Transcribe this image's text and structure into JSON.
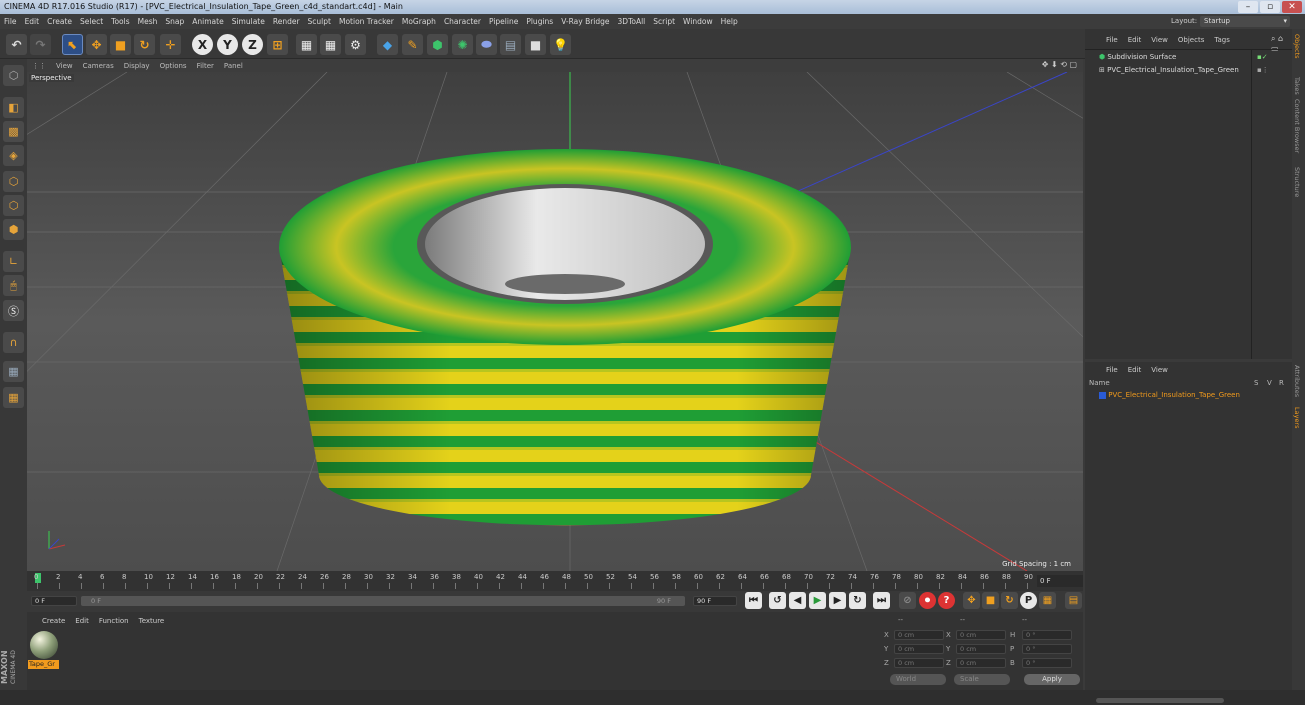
{
  "window": {
    "title": "CINEMA 4D R17.016 Studio (R17) - [PVC_Electrical_Insulation_Tape_Green_c4d_standart.c4d] - Main"
  },
  "menu": [
    "File",
    "Edit",
    "Create",
    "Select",
    "Tools",
    "Mesh",
    "Snap",
    "Animate",
    "Simulate",
    "Render",
    "Sculpt",
    "Motion Tracker",
    "MoGraph",
    "Character",
    "Pipeline",
    "Plugins",
    "V-Ray Bridge",
    "3DToAll",
    "Script",
    "Window",
    "Help"
  ],
  "layout": {
    "label": "Layout:",
    "value": "Startup"
  },
  "toolbar": {
    "x": "X",
    "y": "Y",
    "z": "Z"
  },
  "viewport": {
    "menu": [
      "View",
      "Cameras",
      "Display",
      "Options",
      "Filter",
      "Panel"
    ],
    "label": "Perspective",
    "grid_spacing": "Grid Spacing : 1 cm"
  },
  "timeline": {
    "ticks": [
      "0",
      "2",
      "4",
      "6",
      "8",
      "10",
      "12",
      "14",
      "16",
      "18",
      "20",
      "22",
      "24",
      "26",
      "28",
      "30",
      "32",
      "34",
      "36",
      "38",
      "40",
      "42",
      "44",
      "46",
      "48",
      "50",
      "52",
      "54",
      "56",
      "58",
      "60",
      "62",
      "64",
      "66",
      "68",
      "70",
      "72",
      "74",
      "76",
      "78",
      "80",
      "82",
      "84",
      "86",
      "88",
      "90"
    ],
    "current": "0 F"
  },
  "transport": {
    "start": "0 F",
    "slider_start": "0 F",
    "slider_end": "90 F",
    "end": "90 F"
  },
  "material_manager": {
    "menu": [
      "Create",
      "Edit",
      "Function",
      "Texture"
    ],
    "material_name": "Tape_Gr"
  },
  "coords": {
    "header": [
      "--",
      "--",
      "--"
    ],
    "rows": [
      [
        "X",
        "0 cm",
        "X",
        "0 cm",
        "H",
        "0 °"
      ],
      [
        "Y",
        "0 cm",
        "Y",
        "0 cm",
        "P",
        "0 °"
      ],
      [
        "Z",
        "0 cm",
        "Z",
        "0 cm",
        "B",
        "0 °"
      ]
    ],
    "mode1": "World",
    "mode2": "Scale",
    "apply": "Apply"
  },
  "object_manager": {
    "menu": [
      "File",
      "Edit",
      "View",
      "Objects",
      "Tags"
    ],
    "objects": [
      "Subdivision Surface",
      "PVC_Electrical_Insulation_Tape_Green"
    ]
  },
  "layer_manager": {
    "menu": [
      "File",
      "Edit",
      "View"
    ],
    "col_name": "Name",
    "col_s": "S",
    "col_v": "V",
    "col_r": "R",
    "layer": "PVC_Electrical_Insulation_Tape_Green"
  },
  "side_tabs": [
    "Objects",
    "Takes",
    "Content Browser",
    "Structure",
    "Attributes",
    "Layers"
  ],
  "brand": {
    "line1": "MAXON",
    "line2": "CINEMA 4D"
  },
  "colors": {
    "accent": "#f29b1d",
    "tape_green": "#1f9e35",
    "tape_yellow": "#e4d21a",
    "layer_blue": "#2a5bd6"
  }
}
